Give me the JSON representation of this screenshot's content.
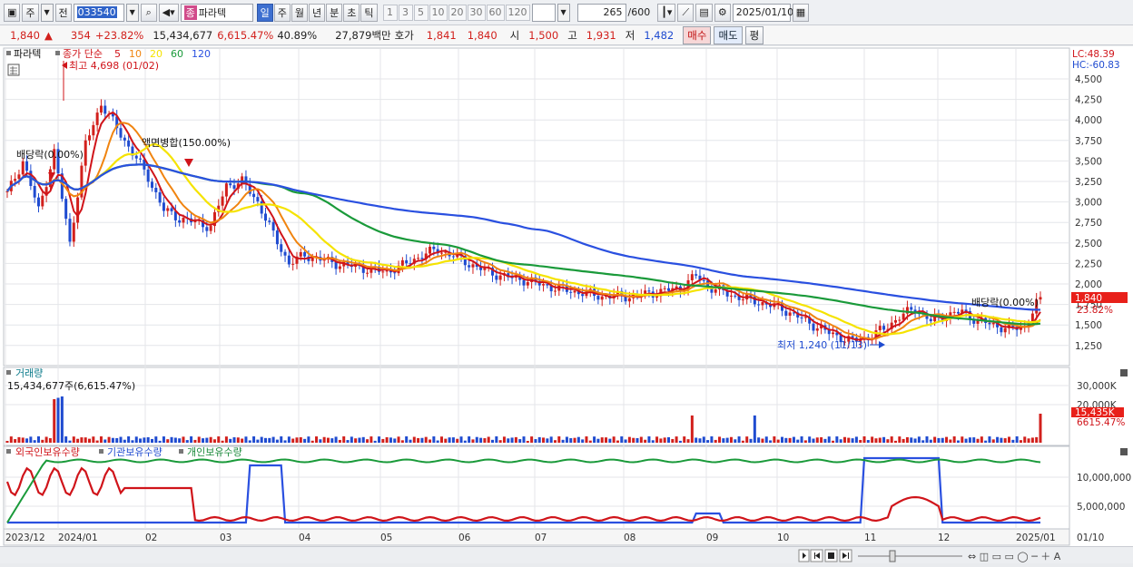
{
  "toolbar": {
    "market": "주",
    "prev_label": "전",
    "code": "033540",
    "name_badge": "종",
    "name": "파라텍",
    "periods": [
      "일",
      "주",
      "월",
      "년",
      "분",
      "초",
      "틱"
    ],
    "intervals": [
      "1",
      "3",
      "5",
      "10",
      "20",
      "30",
      "60",
      "120"
    ],
    "count": "265",
    "total": "/600",
    "date": "2025/01/10"
  },
  "quote": {
    "price": "1,840",
    "arrow": "▲",
    "change": "354",
    "change_pct": "+23.82%",
    "volume": "15,434,677",
    "volume_pct": "6,615.47%",
    "rate": "40.89%",
    "amount": "27,879백만",
    "bid_label": "호가",
    "ask1": "1,841",
    "bid1": "1,840",
    "open_label": "시",
    "open": "1,500",
    "high_label": "고",
    "high": "1,931",
    "low_label": "저",
    "low": "1,482",
    "buy_btn": "매수",
    "sell_btn": "매도",
    "eval_btn": "평"
  },
  "legend": {
    "stock": "파라텍",
    "close_label": "종가 단순",
    "ma": [
      "5",
      "10",
      "20",
      "60",
      "120"
    ],
    "ma_colors": [
      "#d0141a",
      "#f08410",
      "#f5e300",
      "#1a9a3a",
      "#2a50e0"
    ]
  },
  "price_axis": {
    "lc": "LC:48.39",
    "hc": "HC:-60.83",
    "ticks": [
      "4,500",
      "4,250",
      "4,000",
      "3,750",
      "3,500",
      "3,250",
      "3,000",
      "2,750",
      "2,500",
      "2,250",
      "2,000",
      "1,750",
      "1,500",
      "1,250"
    ],
    "current": "1,840",
    "current_pct": "23.82%"
  },
  "annotations": {
    "high": "최고 4,698 (01/02)",
    "low": "최저 1,240 (11/13)",
    "dividend1": "배당락(0.00%)",
    "split": "액면병합(150.00%)",
    "dividend2": "배당락(0.00%)"
  },
  "volume_panel": {
    "title": "거래량",
    "value": "15,434,677주(6,615.47%)",
    "ticks": [
      "30,000K",
      "20,000K"
    ],
    "current": "15,435K",
    "current_pct": "6615.47%"
  },
  "holdings_panel": {
    "foreign": "외국인보유수량",
    "institution": "기관보유수량",
    "individual": "개인보유수량",
    "ticks": [
      "10,000,000",
      "5,000,000"
    ]
  },
  "date_axis": {
    "labels": [
      "2023/12",
      "2024/01",
      "02",
      "03",
      "04",
      "05",
      "06",
      "07",
      "08",
      "09",
      "10",
      "11",
      "12",
      "2025/01"
    ],
    "right_label": "01/10"
  },
  "colors": {
    "up": "#d2201c",
    "down": "#1f4bd0",
    "price_tag": "#e8201a"
  }
}
